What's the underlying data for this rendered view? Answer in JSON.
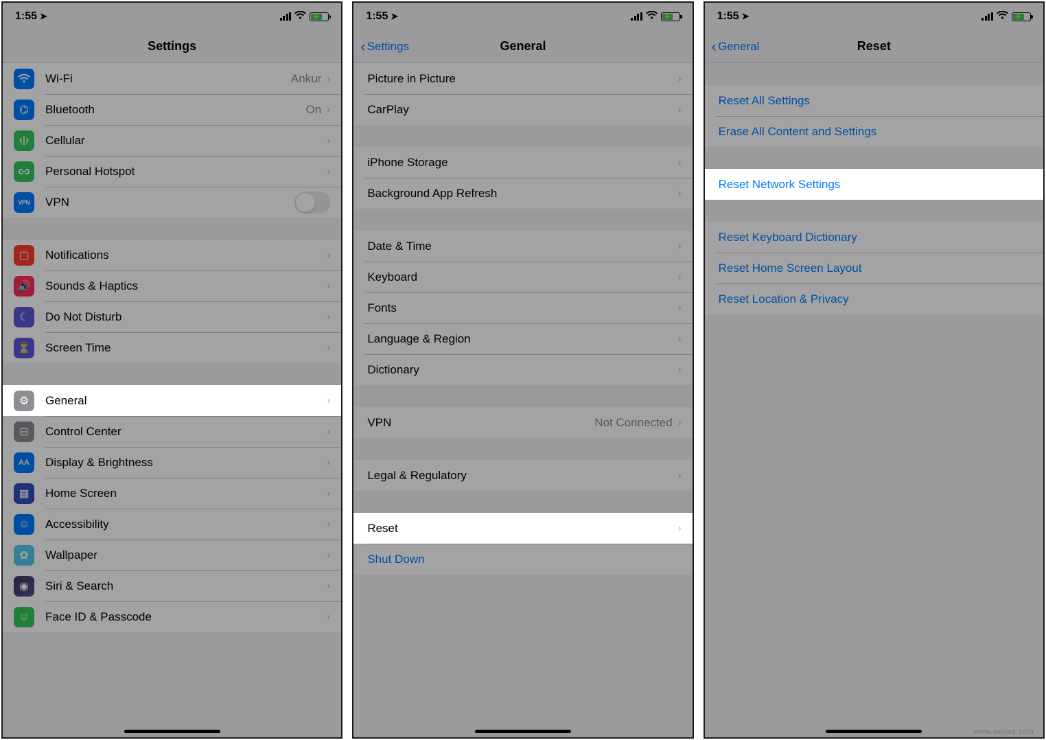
{
  "status": {
    "time": "1:55",
    "location_icon": "◤"
  },
  "screen1": {
    "title": "Settings",
    "g1": [
      {
        "icon": "wifi",
        "label": "Wi-Fi",
        "detail": "Ankur"
      },
      {
        "icon": "bluetooth",
        "label": "Bluetooth",
        "detail": "On"
      },
      {
        "icon": "cellular",
        "label": "Cellular",
        "detail": ""
      },
      {
        "icon": "hotspot",
        "label": "Personal Hotspot",
        "detail": ""
      },
      {
        "icon": "vpn",
        "label": "VPN",
        "toggle": false
      }
    ],
    "g2": [
      {
        "icon": "notifications",
        "label": "Notifications"
      },
      {
        "icon": "sounds",
        "label": "Sounds & Haptics"
      },
      {
        "icon": "dnd",
        "label": "Do Not Disturb"
      },
      {
        "icon": "screentime",
        "label": "Screen Time"
      }
    ],
    "g3": [
      {
        "icon": "general",
        "label": "General",
        "highlight": true
      },
      {
        "icon": "controlcenter",
        "label": "Control Center"
      },
      {
        "icon": "display",
        "label": "Display & Brightness"
      },
      {
        "icon": "homescreen",
        "label": "Home Screen"
      },
      {
        "icon": "accessibility",
        "label": "Accessibility"
      },
      {
        "icon": "wallpaper",
        "label": "Wallpaper"
      },
      {
        "icon": "siri",
        "label": "Siri & Search"
      },
      {
        "icon": "faceid",
        "label": "Face ID & Passcode"
      }
    ]
  },
  "screen2": {
    "back": "Settings",
    "title": "General",
    "g0": [
      {
        "label": "Picture in Picture"
      },
      {
        "label": "CarPlay"
      }
    ],
    "g1": [
      {
        "label": "iPhone Storage"
      },
      {
        "label": "Background App Refresh"
      }
    ],
    "g2": [
      {
        "label": "Date & Time"
      },
      {
        "label": "Keyboard"
      },
      {
        "label": "Fonts"
      },
      {
        "label": "Language & Region"
      },
      {
        "label": "Dictionary"
      }
    ],
    "g3": [
      {
        "label": "VPN",
        "detail": "Not Connected"
      }
    ],
    "g4": [
      {
        "label": "Legal & Regulatory"
      }
    ],
    "g5": [
      {
        "label": "Reset",
        "highlight": true
      },
      {
        "label": "Shut Down",
        "link": true
      }
    ]
  },
  "screen3": {
    "back": "General",
    "title": "Reset",
    "g1": [
      {
        "label": "Reset All Settings"
      },
      {
        "label": "Erase All Content and Settings"
      }
    ],
    "g2": [
      {
        "label": "Reset Network Settings",
        "highlight": true
      }
    ],
    "g3": [
      {
        "label": "Reset Keyboard Dictionary"
      },
      {
        "label": "Reset Home Screen Layout"
      },
      {
        "label": "Reset Location & Privacy"
      }
    ]
  },
  "watermark": "www.deuaq.com"
}
